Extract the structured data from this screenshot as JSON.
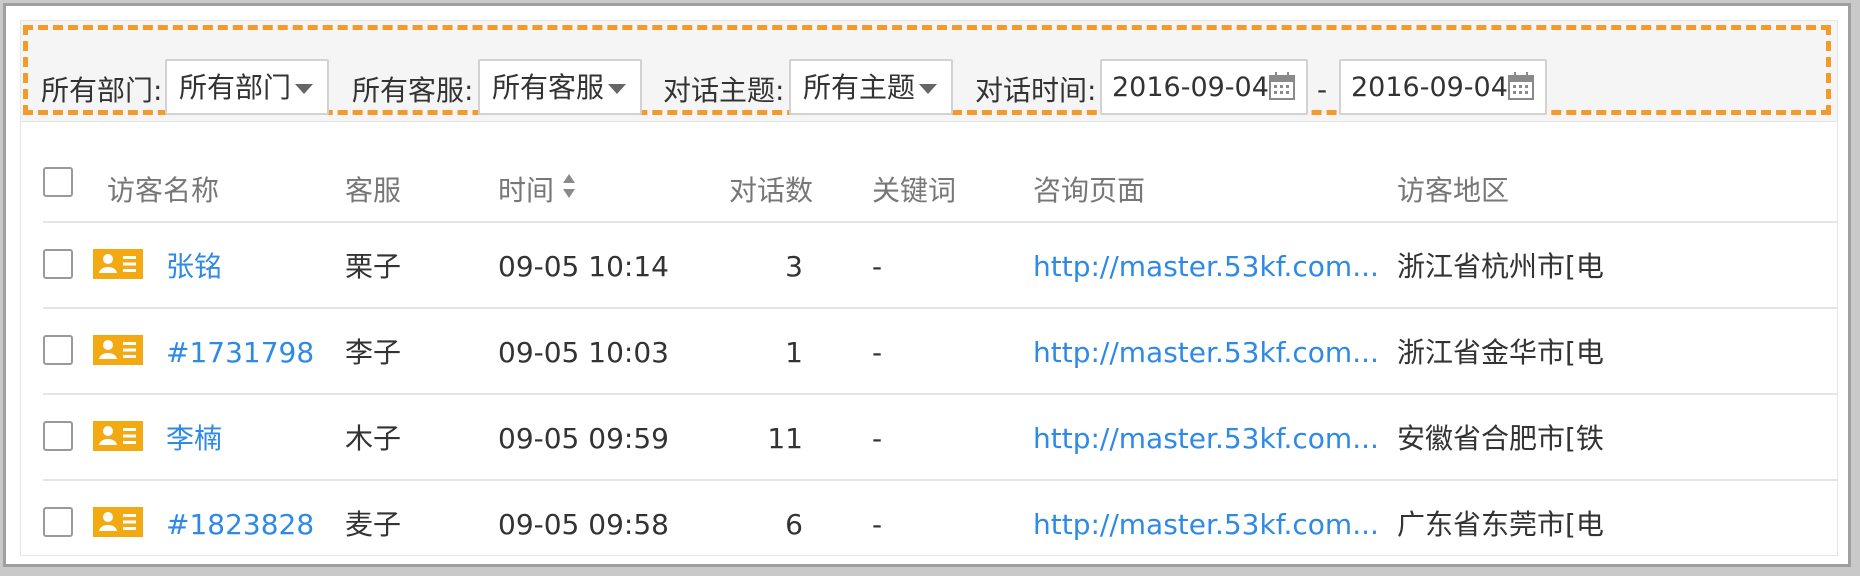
{
  "filters": {
    "department_label": "所有部门:",
    "department_value": "所有部门",
    "service_label": "所有客服:",
    "service_value": "所有客服",
    "topic_label": "对话主题:",
    "topic_value": "所有主题",
    "time_label": "对话时间:",
    "start_date": "2016-09-04",
    "separator": "-",
    "end_date": "2016-09-04"
  },
  "table": {
    "headers": [
      "访客名称",
      "客服",
      "时间",
      "对话数",
      "关键词",
      "咨询页面",
      "访客地区"
    ],
    "rows": [
      [
        "张铭",
        "栗子",
        "09-05 10:14",
        "3",
        "-",
        "http://master.53kf.com...",
        "浙江省杭州市[电"
      ],
      [
        "#1731798",
        "李子",
        "09-05 10:03",
        "1",
        "-",
        "http://master.53kf.com...",
        "浙江省金华市[电"
      ],
      [
        "李楠",
        "木子",
        "09-05 09:59",
        "11",
        "-",
        "http://master.53kf.com...",
        "安徽省合肥市[铁"
      ],
      [
        "#1823828",
        "麦子",
        "09-05 09:58",
        "6",
        "-",
        "http://master.53kf.com...",
        "广东省东莞市[电"
      ]
    ]
  },
  "icons": {
    "calendar": "calendar-icon",
    "card": "visitor-card-icon",
    "sort": "sort-icon"
  },
  "colors": {
    "accent_orange": "#f39a2d",
    "card_yellow": "#f3a911",
    "link_blue": "#2f8ae5"
  }
}
